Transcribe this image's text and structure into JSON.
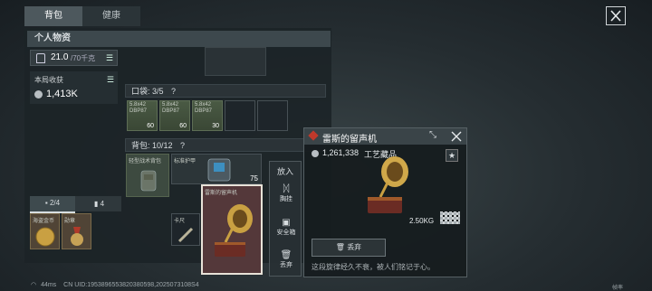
{
  "tabs": [
    {
      "label": "背包"
    },
    {
      "label": "健康"
    }
  ],
  "personal": {
    "title": "个人物资",
    "weight_value": "21.0",
    "weight_cap": "/70千克",
    "earnings_label": "本局收获",
    "earnings_value": "1,413K",
    "counters": {
      "a": "2/4",
      "b": "4"
    }
  },
  "pocket": {
    "label": "口袋: 3/5",
    "help": "?",
    "ammo": [
      {
        "name": "5.8x42 DBP87",
        "count": "60"
      },
      {
        "name": "5.8x42 DBP87",
        "count": "60"
      },
      {
        "name": "5.8x42 DBP87",
        "count": "30"
      }
    ]
  },
  "backpack": {
    "label": "背包: 10/12",
    "help": "?",
    "vest_label": "轻型战术背包",
    "armor_label": "标准护甲",
    "armor_value": "75",
    "gramophone_label": "雷斯的留声机",
    "card_label": "卡尺"
  },
  "medals": {
    "a": "海盗金币",
    "b": "勋章"
  },
  "actions": {
    "title": "放入",
    "items": [
      {
        "label": "胸挂"
      },
      {
        "label": "安全箱"
      },
      {
        "label": "丢弃"
      }
    ]
  },
  "detail": {
    "title": "雷斯的留声机",
    "price": "1,261,338",
    "category": "工艺藏品",
    "weight": "2.50KG",
    "discard_label": "丢弃",
    "description": "这段旋律经久不衰，被人们铭记于心。"
  },
  "status": {
    "ping": "44ms",
    "uid": "CN UID:1953896553820380598,2025073108S4"
  },
  "corner": "帧率"
}
